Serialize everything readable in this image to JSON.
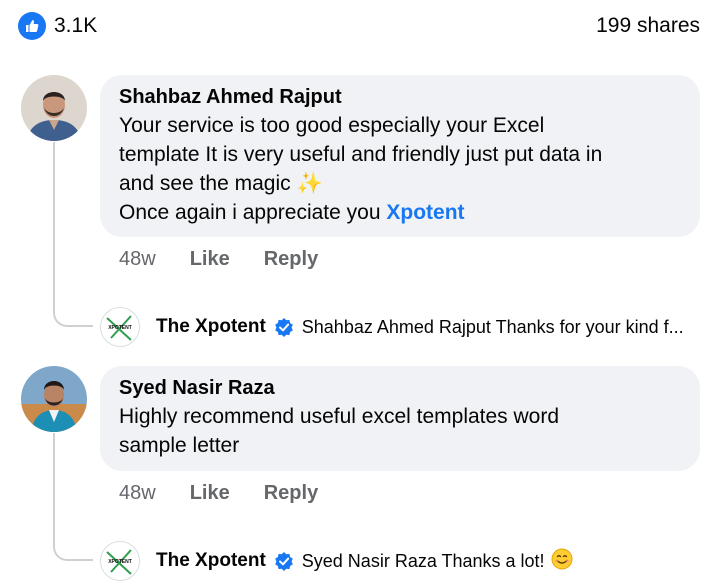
{
  "reactions": {
    "count": "3.1K",
    "icon": "thumbs-up-icon"
  },
  "shares": "199 shares",
  "comments": [
    {
      "author": "Shahbaz Ahmed Rajput",
      "lines": [
        "Your service is too good especially your Excel",
        "template It is very useful and friendly just put data in",
        "and see the magic"
      ],
      "emoji": "✨",
      "last_line": "Once again i appreciate you",
      "mention": "Xpotent",
      "time": "48w",
      "like": "Like",
      "reply": "Reply",
      "reply_preview": {
        "author": "The Xpotent",
        "text": "Shahbaz Ahmed Rajput Thanks for your kind f..."
      }
    },
    {
      "author": "Syed Nasir Raza",
      "lines": [
        "Highly recommend useful excel templates word",
        "sample letter"
      ],
      "time": "48w",
      "like": "Like",
      "reply": "Reply",
      "reply_preview": {
        "author": "The Xpotent",
        "text": "Syed Nasir Raza Thanks a lot!"
      }
    }
  ],
  "logo_text": "XPOTENT",
  "colors": {
    "accent": "#1877f2",
    "bubble": "#f0f2f5",
    "muted": "#65676b"
  }
}
